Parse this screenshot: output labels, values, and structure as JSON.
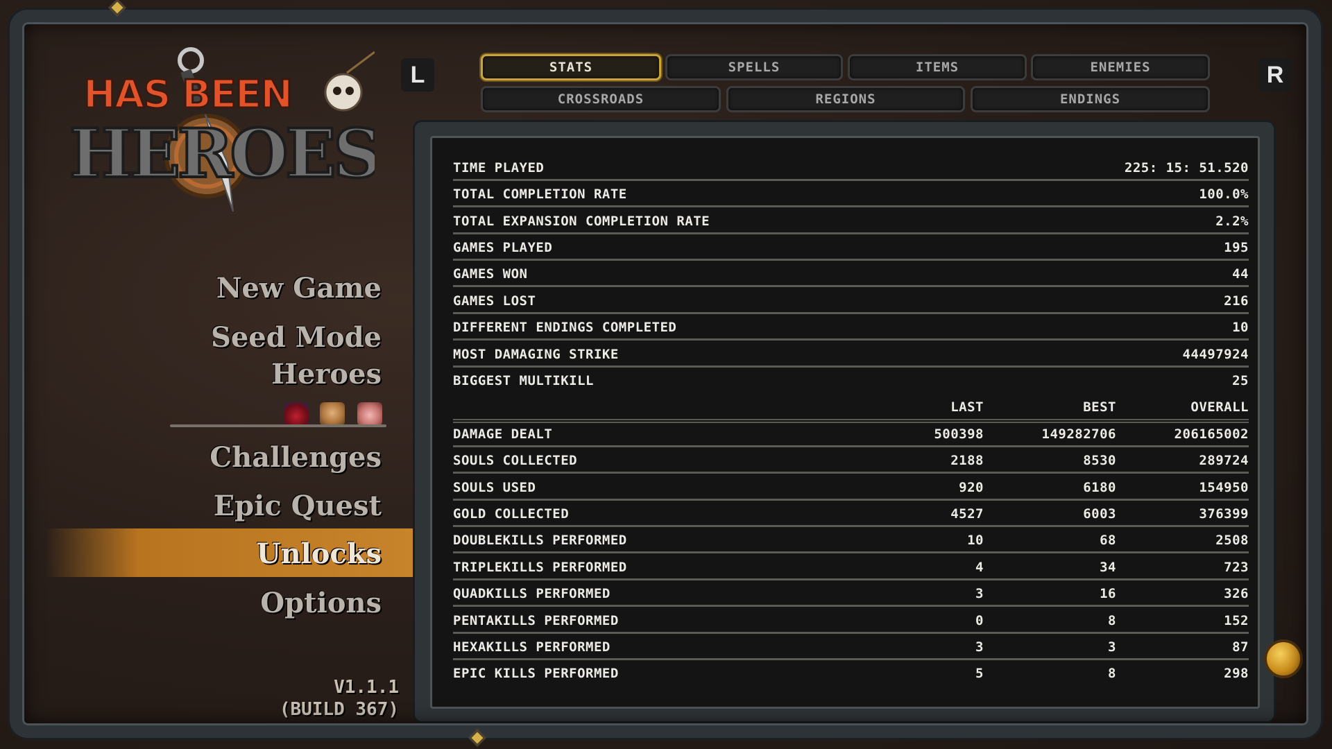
{
  "logo": {
    "line1": "HAS BEEN",
    "line2": "HEROES"
  },
  "menu": {
    "items": [
      "New Game",
      "Seed Mode",
      "Heroes",
      "Challenges",
      "Epic Quest",
      "Unlocks",
      "Options"
    ],
    "selected": "Unlocks"
  },
  "version": {
    "number": "V1.1.1",
    "build": "(BUILD 367)"
  },
  "shoulders": {
    "left": "L",
    "right": "R"
  },
  "tabs": {
    "row1": [
      "STATS",
      "SPELLS",
      "ITEMS",
      "ENEMIES"
    ],
    "row2": [
      "CROSSROADS",
      "REGIONS",
      "ENDINGS"
    ],
    "active": "STATS"
  },
  "stats": {
    "summary": [
      {
        "label": "TIME PLAYED",
        "value": "225: 15: 51.520"
      },
      {
        "label": "TOTAL COMPLETION RATE",
        "value": "100.0%"
      },
      {
        "label": "TOTAL EXPANSION COMPLETION RATE",
        "value": "2.2%"
      },
      {
        "label": "GAMES PLAYED",
        "value": "195"
      },
      {
        "label": "GAMES WON",
        "value": "44"
      },
      {
        "label": "GAMES LOST",
        "value": "216"
      },
      {
        "label": "DIFFERENT ENDINGS COMPLETED",
        "value": "10"
      },
      {
        "label": "MOST DAMAGING STRIKE",
        "value": "44497924"
      },
      {
        "label": "BIGGEST MULTIKILL",
        "value": "25"
      }
    ],
    "columns": [
      "LAST",
      "BEST",
      "OVERALL"
    ],
    "detail": [
      {
        "label": "DAMAGE DEALT",
        "last": "500398",
        "best": "149282706",
        "overall": "206165002"
      },
      {
        "label": "SOULS COLLECTED",
        "last": "2188",
        "best": "8530",
        "overall": "289724"
      },
      {
        "label": "SOULS USED",
        "last": "920",
        "best": "6180",
        "overall": "154950"
      },
      {
        "label": "GOLD COLLECTED",
        "last": "4527",
        "best": "6003",
        "overall": "376399"
      },
      {
        "label": "DOUBLEKILLS PERFORMED",
        "last": "10",
        "best": "68",
        "overall": "2508"
      },
      {
        "label": "TRIPLEKILLS PERFORMED",
        "last": "4",
        "best": "34",
        "overall": "723"
      },
      {
        "label": "QUADKILLS PERFORMED",
        "last": "3",
        "best": "16",
        "overall": "326"
      },
      {
        "label": "PENTAKILLS PERFORMED",
        "last": "0",
        "best": "8",
        "overall": "152"
      },
      {
        "label": "HEXAKILLS PERFORMED",
        "last": "3",
        "best": "3",
        "overall": "87"
      },
      {
        "label": "EPIC KILLS PERFORMED",
        "last": "5",
        "best": "8",
        "overall": "298"
      }
    ]
  },
  "colors": {
    "accent_gold": "#c9a43a",
    "menu_highlight": "#c8842b",
    "text_light": "#ecebe6"
  },
  "icons": [
    "rogue-hero-icon",
    "warrior-hero-icon",
    "pig-hero-icon",
    "coin-orb-icon",
    "sword-icon",
    "skull-icon"
  ]
}
